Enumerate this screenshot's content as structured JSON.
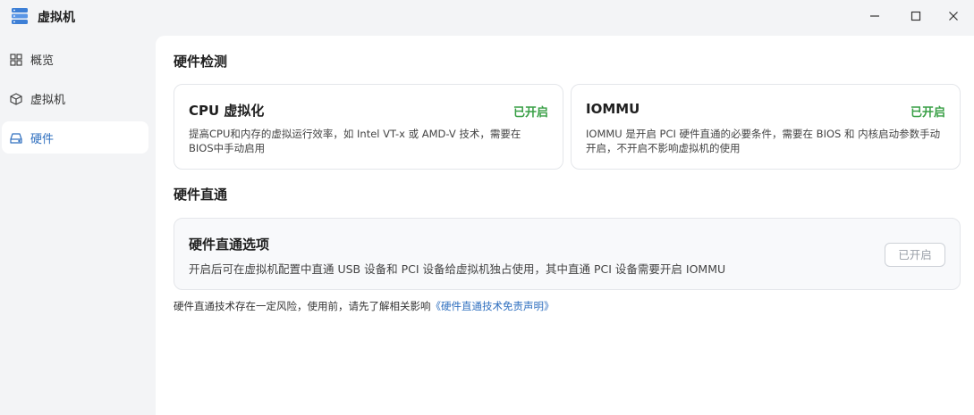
{
  "app": {
    "title": "虚拟机",
    "icon": "server-stack-icon",
    "accent": "#2f6fbf"
  },
  "window_controls": [
    "minimize-icon",
    "maximize-icon",
    "close-icon"
  ],
  "sidebar": {
    "items": [
      {
        "label": "概览",
        "icon": "grid-icon",
        "active": false
      },
      {
        "label": "虚拟机",
        "icon": "cube-icon",
        "active": false
      },
      {
        "label": "硬件",
        "icon": "drive-icon",
        "active": true
      }
    ]
  },
  "main": {
    "detect_title": "硬件检测",
    "cards": [
      {
        "title": "CPU 虚拟化",
        "status": "已开启",
        "desc": "提高CPU和内存的虚拟运行效率，如 Intel VT-x 或 AMD-V 技术，需要在 BIOS中手动启用"
      },
      {
        "title": "IOMMU",
        "status": "已开启",
        "desc": "IOMMU 是开启 PCI 硬件直通的必要条件，需要在 BIOS 和 内核启动参数手动开启，不开启不影响虚拟机的使用"
      }
    ],
    "passthrough_title": "硬件直通",
    "passthrough_card": {
      "title": "硬件直通选项",
      "desc": "开启后可在虚拟机配置中直通 USB 设备和 PCI 设备给虚拟机独占使用，其中直通 PCI 设备需要开启 IOMMU",
      "button": "已开启"
    },
    "note_text": "硬件直通技术存在一定风险，使用前，请先了解相关影响",
    "note_link": "《硬件直通技术免责声明》",
    "status_color": "#3aa047"
  }
}
